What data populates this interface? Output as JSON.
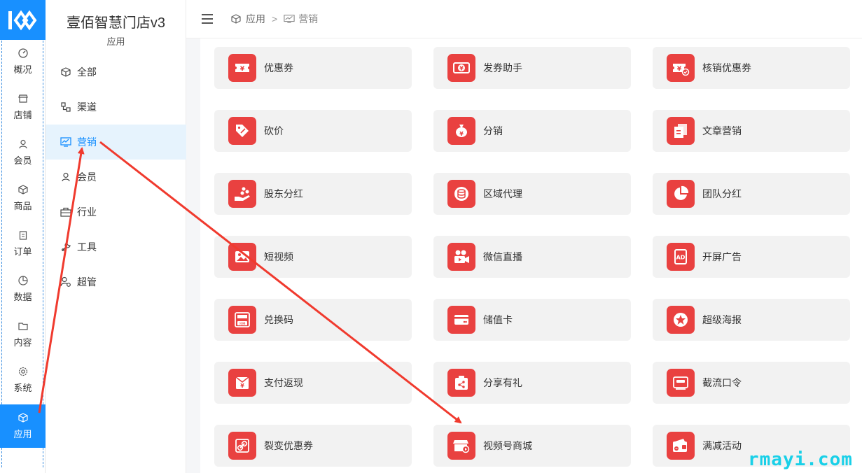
{
  "rail": {
    "items": [
      {
        "label": "概况",
        "icon": "dashboard-icon"
      },
      {
        "label": "店铺",
        "icon": "store-icon"
      },
      {
        "label": "会员",
        "icon": "user-icon"
      },
      {
        "label": "商品",
        "icon": "cube-icon"
      },
      {
        "label": "订单",
        "icon": "clipboard-icon"
      },
      {
        "label": "数据",
        "icon": "pie-icon"
      },
      {
        "label": "内容",
        "icon": "folder-icon"
      },
      {
        "label": "系统",
        "icon": "gear-icon"
      },
      {
        "label": "应用",
        "icon": "cube-icon",
        "active": true
      }
    ]
  },
  "sidebar": {
    "brand": "壹佰智慧门店v3",
    "section": "应用",
    "items": [
      {
        "label": "全部",
        "icon": "cube-icon"
      },
      {
        "label": "渠道",
        "icon": "channel-icon"
      },
      {
        "label": "营销",
        "icon": "monitor-chart-icon",
        "active": true
      },
      {
        "label": "会员",
        "icon": "user-icon"
      },
      {
        "label": "行业",
        "icon": "briefcase-icon"
      },
      {
        "label": "工具",
        "icon": "tools-icon"
      },
      {
        "label": "超管",
        "icon": "admin-icon"
      }
    ]
  },
  "breadcrumb": {
    "level1": "应用",
    "separator": ">",
    "level2": "营销"
  },
  "apps": [
    [
      "优惠券",
      "发券助手",
      "核销优惠券"
    ],
    [
      "砍价",
      "分销",
      "文章营销"
    ],
    [
      "股东分红",
      "区域代理",
      "团队分红"
    ],
    [
      "短视频",
      "微信直播",
      "开屏广告"
    ],
    [
      "兑换码",
      "储值卡",
      "超级海报"
    ],
    [
      "支付返现",
      "分享有礼",
      "截流口令"
    ],
    [
      "裂变优惠券",
      "视频号商城",
      "满减活动"
    ]
  ],
  "badge_texts": {
    "yen": "¥",
    "ad": "AD",
    "redeem": "兑换"
  },
  "watermark": "rmayi.com",
  "colors": {
    "accent": "#1890ff",
    "app_red": "#e94140",
    "arrow": "#f03a2e"
  }
}
